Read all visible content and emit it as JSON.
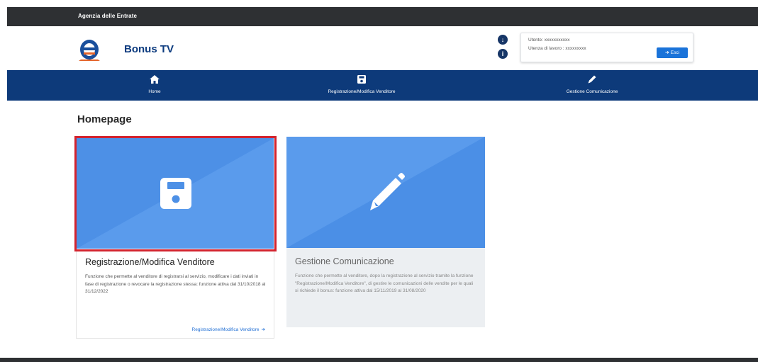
{
  "topbar": {
    "agency": "Agenzia delle Entrate"
  },
  "header": {
    "brand": "Bonus TV",
    "icons": [
      "download-icon",
      "info-icon"
    ],
    "user": {
      "utente_line": "Utente: xxxxxxxxxxx",
      "utenza_line": "Utenza di lavoro : xxxxxxxxx",
      "exit_label": "Esci",
      "exit_icon": "sign-out-icon"
    }
  },
  "nav": {
    "items": [
      {
        "label": "Home",
        "icon": "home-icon"
      },
      {
        "label": "Registrazione/Modifica Venditore",
        "icon": "save-icon"
      },
      {
        "label": "Gestione Comunicazione",
        "icon": "pencil-icon"
      }
    ]
  },
  "page": {
    "title": "Homepage"
  },
  "cards": [
    {
      "title": "Registrazione/Modifica Venditore",
      "description": "Funzione che permette al venditore di registrarsi al servizio, modificare i dati inviati in fase di registrazione o revocare la registrazione stessa: funzione attiva dal 31/10/2018 al 31/12/2022",
      "link": "Registrazione/Modifica Venditore",
      "icon": "save-icon",
      "highlight_color": "#d3232e"
    },
    {
      "title": "Gestione Comunicazione",
      "description": "Funzione che permette al venditore, dopo la registrazione al servizio tramite la funzione \"Registrazione/Modifica Venditore\", di gestire le comunicazioni delle vendite per le quali si richiede il bonus: funzione attiva dal 15/11/2019 al 31/08/2020",
      "icon": "pencil-icon"
    }
  ],
  "colors": {
    "nav_bg": "#0d3a7a",
    "card_image_bg": "#4d90e6",
    "link": "#1f6ed4",
    "exit_button": "#1a73d9"
  }
}
